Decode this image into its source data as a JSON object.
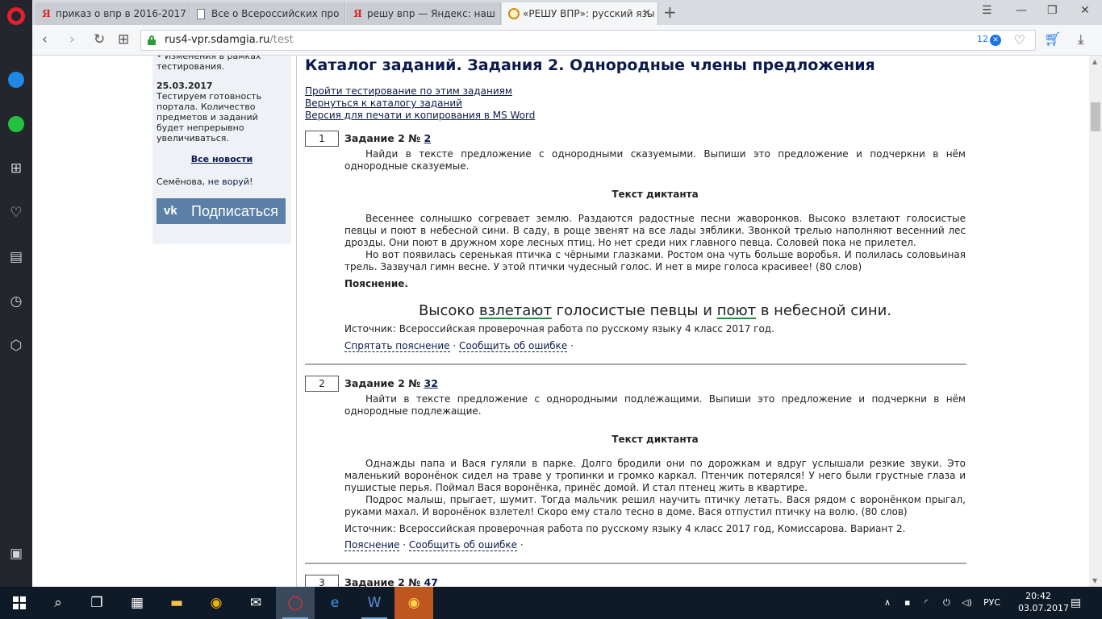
{
  "browser": {
    "tabs": [
      {
        "label": "приказ о впр в 2016-2017",
        "icon": "yandex-icon"
      },
      {
        "label": "Все о Всероссийских про",
        "icon": "document-icon"
      },
      {
        "label": "решу впр — Яндекс: наш",
        "icon": "yandex-icon"
      },
      {
        "label": "«РЕШУ ВПР»: русский язы",
        "icon": "sun-icon",
        "active": true
      }
    ],
    "url_host": "rus4-vpr.sdamgia.ru",
    "url_path": "/test",
    "adblock_count": "12"
  },
  "sidebar": {
    "cut_text": "• Изменения в рамках тестирования.",
    "news_date": "25.03.2017",
    "news_text": "Тестируем готовность портала. Количество предметов и заданий будет непрерывно увеличиваться.",
    "all_news": "Все новости",
    "author_name": "Семёнова, ",
    "author_link": "не воруй",
    "author_tail": "!",
    "vk_logo": "vk",
    "vk_button": "Подписаться"
  },
  "main": {
    "title": "Каталог заданий. Задания 2. Однородные члены предложения",
    "links": [
      "Пройти тестирование по этим заданиям",
      "Вернуться к каталогу заданий",
      "Версия для печати и копирования в MS Word"
    ]
  },
  "tasks": [
    {
      "number": "1",
      "label": "Задание 2 № ",
      "id": "2",
      "prompt": "Найди в тексте предложение с однородными сказуемыми. Выпиши это предложение и подчеркни в нём однородные сказуемые.",
      "text_title": "Текст диктанта",
      "text_p1": "Весеннее солнышко согревает землю. Раздаются радостные песни жаворонков. Высоко взлетают голосистые певцы и поют в небесной сини. В саду, в роще звенят на все лады зяблики. Звонкой трелью наполняют весенний лес дрозды. Они поют в дружном хоре лесных птиц. Но нет среди них главного певца. Соловей пока не прилетел.",
      "text_p2": "Но вот появилась серенькая птичка с чёрными глазками. Ростом она чуть больше воробья. И полилась соловьиная трель. Зазвучал гимн весне. У этой птички чудесный голос. И нет в мире голоса красивее! (80 слов)",
      "explanation_label": "Пояснение.",
      "answer": {
        "a1": "Высоко ",
        "u1": "взлетают",
        "a2": " голосистые певцы и ",
        "u2": "поют",
        "a3": " в небесной сини."
      },
      "source": "Источник: Всероссийская проверочная работа по русскому языку 4 класс 2017 год.",
      "action1": "Спрятать пояснение",
      "action2": "Сообщить об ошибке",
      "action_sep": " · "
    },
    {
      "number": "2",
      "label": "Задание 2 № ",
      "id": "32",
      "prompt": "Найти в тексте предложение с однородными подлежащими. Выпиши это предложение и подчеркни в нём однородные подлежащие.",
      "text_title": "Текст диктанта",
      "text_p1": "Однажды папа и Вася гуляли в парке. Долго бродили они по дорожкам и вдруг услышали резкие звуки. Это маленький воронёнок сидел на траве у тропинки и громко каркал. Птенчик потерялся! У него были грустные глаза и пушистые перья. Поймал Вася воронёнка, принёс домой. И стал птенец жить в квартире.",
      "text_p2": "Подрос малыш, прыгает, шумит. Тогда мальчик решил научить птичку летать. Вася рядом с воронёнком прыгал, руками махал. И воронёнок взлетел! Скоро ему стало тесно в доме. Вася отпустил птичку на волю. (80 слов)",
      "source": "Источник: Всероссийская проверочная работа по русскому языку 4 класс 2017 год, Комиссарова. Вариант 2.",
      "action1": "Пояснение",
      "action2": "Сообщить об ошибке",
      "action_sep": " · "
    },
    {
      "number": "3",
      "label": "Задание 2 № ",
      "id": "47"
    }
  ],
  "taskbar": {
    "language": "РУС",
    "time": "20:42",
    "date": "03.07.2017"
  },
  "colors": {
    "heading": "#0b1a4d",
    "vk_button": "#5b7fa6",
    "opera_red": "#e4202a",
    "taskbar": "#0e1a28",
    "underline_green": "#2e8a3a"
  }
}
